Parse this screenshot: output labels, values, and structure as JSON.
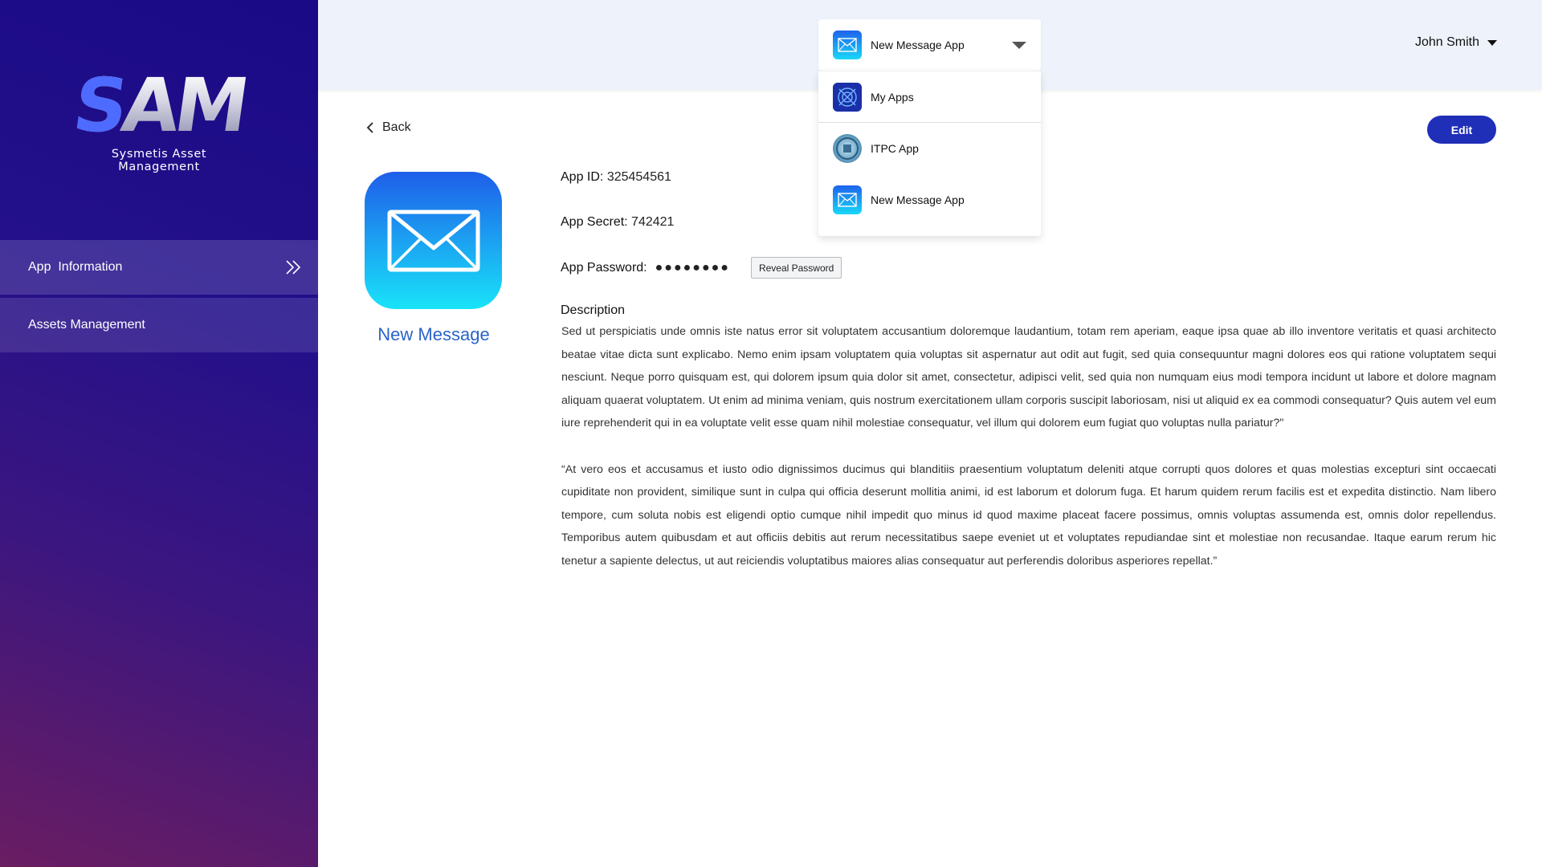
{
  "logo": {
    "text_s": "S",
    "text_am": "AM",
    "subtitle": "Sysmetis Asset Management"
  },
  "sidebar": {
    "items": [
      {
        "label": "App  Information",
        "active": true
      },
      {
        "label": "Assets Management",
        "active": false
      }
    ]
  },
  "header": {
    "user_name": "John Smith",
    "selector": {
      "selected": "New Message App",
      "icon": "mail-icon"
    },
    "dropdown": [
      {
        "label": "My Apps",
        "icon": "my-apps-icon"
      },
      {
        "label": "ITPC App",
        "icon": "itpc-logo-icon"
      },
      {
        "label": "New Message App",
        "icon": "mail-icon"
      }
    ]
  },
  "main": {
    "back_label": "Back",
    "edit_label": "Edit",
    "app_name": "New Message",
    "app_id_label": "App ID",
    "app_id_value": ": 325454561",
    "app_secret_label": "App Secret",
    "app_secret_value": ": 742421",
    "app_password_label": "App Password",
    "app_password_colon": ":",
    "app_password_mask": "●●●●●●●●",
    "reveal_label": "Reveal Password",
    "description_title": "Description",
    "description_p1": "Sed ut perspiciatis unde omnis iste natus error sit voluptatem accusantium doloremque laudantium, totam rem aperiam, eaque ipsa quae ab illo inventore veritatis et quasi architecto beatae vitae dicta sunt explicabo. Nemo enim ipsam voluptatem quia voluptas sit aspernatur aut odit aut fugit, sed quia consequuntur magni dolores eos qui ratione voluptatem sequi nesciunt. Neque porro quisquam est, qui dolorem ipsum quia dolor sit amet, consectetur, adipisci velit, sed quia non numquam eius modi tempora incidunt ut labore et dolore magnam aliquam quaerat voluptatem. Ut enim ad minima veniam, quis nostrum exercitationem ullam corporis suscipit laboriosam, nisi ut aliquid ex ea commodi consequatur? Quis autem vel eum iure reprehenderit qui in ea voluptate velit esse quam nihil molestiae consequatur, vel illum qui dolorem eum fugiat quo voluptas nulla pariatur?\"",
    "description_p2": "“At vero eos et accusamus et iusto odio dignissimos ducimus qui blanditiis praesentium voluptatum deleniti atque corrupti quos dolores et quas molestias excepturi sint occaecati cupiditate non provident, similique sunt in culpa qui officia deserunt mollitia animi, id est laborum et dolorum fuga. Et harum quidem rerum facilis est et expedita distinctio. Nam libero tempore, cum soluta nobis est eligendi optio cumque nihil impedit quo minus id quod maxime placeat facere possimus, omnis voluptas assumenda est, omnis dolor repellendus. Temporibus autem quibusdam et aut officiis debitis aut rerum necessitatibus saepe eveniet ut et voluptates repudiandae sint et molestiae non recusandae. Itaque earum rerum hic tenetur a sapiente delectus, ut aut reiciendis voluptatibus maiores alias consequatur aut perferendis doloribus asperiores repellat.”"
  },
  "colors": {
    "sidebar_top": "#1a0a86",
    "sidebar_bottom": "#6a1d62",
    "accent_button": "#1f2fb8",
    "app_name": "#2a64c9",
    "topbar_bg": "#eef2fa"
  }
}
